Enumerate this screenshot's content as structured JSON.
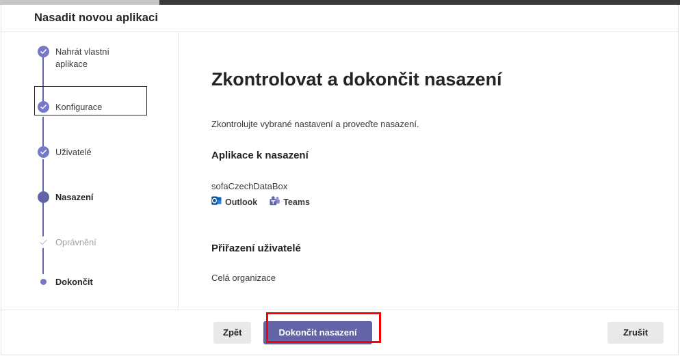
{
  "window": {
    "title": "Nasadit novou aplikaci"
  },
  "stepper": {
    "steps": [
      {
        "label": "Nahrát vlastní\naplikace",
        "state": "completed",
        "focused": true
      },
      {
        "label": "Konfigurace",
        "state": "completed",
        "focused": false
      },
      {
        "label": "Uživatelé",
        "state": "completed",
        "focused": false
      },
      {
        "label": "Nasazení",
        "state": "current",
        "focused": false
      },
      {
        "label": "Oprávnění",
        "state": "pending-check",
        "focused": false
      },
      {
        "label": "Dokončit",
        "state": "pending-dot",
        "focused": false
      }
    ]
  },
  "content": {
    "page_title": "Zkontrolovat a dokončit nasazení",
    "subtitle": "Zkontrolujte vybrané nastavení a proveďte nasazení.",
    "app_section_heading": "Aplikace k nasazení",
    "app_name": "sofaCzechDataBox",
    "badges": [
      {
        "label": "Outlook",
        "icon": "outlook-icon",
        "color": "#0f6cbd"
      },
      {
        "label": "Teams",
        "icon": "teams-icon",
        "color": "#6264a7"
      }
    ],
    "assign_heading": "Přiřazení uživatelé",
    "assign_value": "Celá organizace"
  },
  "footer": {
    "back_label": "Zpět",
    "primary_label": "Dokončit nasazení",
    "cancel_label": "Zrušit"
  },
  "colors": {
    "brand_purple": "#6264a7",
    "step_purple": "#7579c7",
    "highlight_red": "#fe0000",
    "button_grey": "#e9e9ea"
  }
}
